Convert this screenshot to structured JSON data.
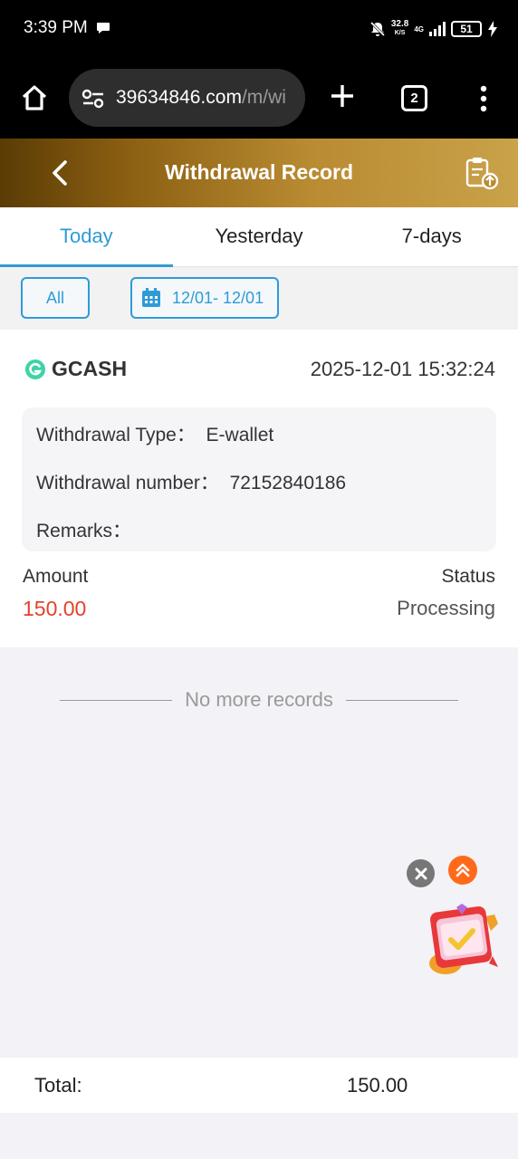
{
  "status_bar": {
    "time": "3:39 PM",
    "speed_value": "32.8",
    "speed_unit": "K/S",
    "network": "4G",
    "battery": "51",
    "icons": [
      "chat-icon",
      "mute-icon",
      "signal-icon",
      "battery-icon",
      "charging-icon"
    ]
  },
  "browser": {
    "url_main": "39634846.com",
    "url_path": "/m/wi",
    "tab_count": "2",
    "icons": [
      "home-icon",
      "site-settings-icon",
      "new-tab-icon",
      "tabs-icon",
      "menu-icon"
    ]
  },
  "header": {
    "title": "Withdrawal Record",
    "icons": [
      "back-icon",
      "record-upload-icon"
    ]
  },
  "period_tabs": [
    {
      "label": "Today",
      "active": true
    },
    {
      "label": "Yesterday",
      "active": false
    },
    {
      "label": "7-days",
      "active": false
    }
  ],
  "filters": {
    "all_label": "All",
    "date_range": "12/01- 12/01"
  },
  "record": {
    "method": "GCASH",
    "datetime": "2025-12-01 15:32:24",
    "type_label": "Withdrawal Type：",
    "type_value": "E-wallet",
    "number_label": "Withdrawal number：",
    "number_value": "72152840186",
    "remarks_label": "Remarks：",
    "remarks_value": "",
    "amount_label": "Amount",
    "amount_value": "150.00",
    "status_label": "Status",
    "status_value": "Processing"
  },
  "no_more": "No more records",
  "total": {
    "label": "Total:",
    "value": "150.00"
  },
  "colors": {
    "accent": "#2f9bd6",
    "amount": "#e0442b",
    "header_start": "#5a3c05",
    "header_end": "#c9a24a",
    "scroll_top": "#ff6a1a"
  }
}
